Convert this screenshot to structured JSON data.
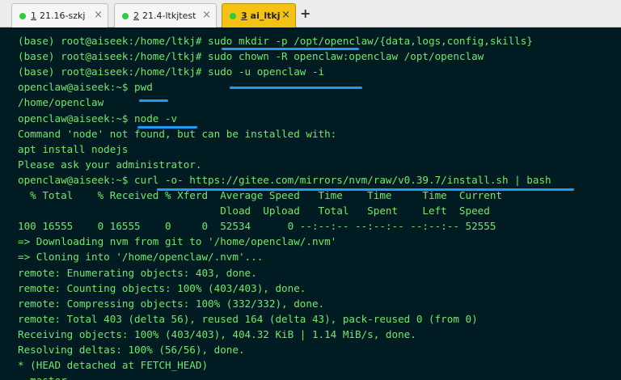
{
  "tabs": [
    {
      "number": "1",
      "label": "21.16-szkj",
      "dot_color": "#2ecc40",
      "active": false
    },
    {
      "number": "2",
      "label": "21.4-ltkjtest",
      "dot_color": "#2ecc40",
      "active": false
    },
    {
      "number": "3",
      "label": "ai_ltkj",
      "dot_color": "#2ecc40",
      "active": true
    }
  ],
  "close_glyph": "×",
  "add_tab_glyph": "+",
  "colors": {
    "terminal_bg": "#001b22",
    "terminal_text": "#72e86a",
    "highlight_underline": "#1f9cf0",
    "active_tab": "#f4c214"
  },
  "terminal": {
    "lines": [
      "(base) root@aiseek:/home/ltkj# sudo mkdir -p /opt/openclaw/{data,logs,config,skills}",
      "(base) root@aiseek:/home/ltkj# sudo chown -R openclaw:openclaw /opt/openclaw",
      "(base) root@aiseek:/home/ltkj# sudo -u openclaw -i",
      "openclaw@aiseek:~$ pwd",
      "/home/openclaw",
      "openclaw@aiseek:~$ node -v",
      "Command 'node' not found, but can be installed with:",
      "apt install nodejs",
      "Please ask your administrator.",
      "openclaw@aiseek:~$ curl -o- https://gitee.com/mirrors/nvm/raw/v0.39.7/install.sh | bash",
      "  % Total    % Received % Xferd  Average Speed   Time    Time     Time  Current",
      "                                 Dload  Upload   Total   Spent    Left  Speed",
      "100 16555    0 16555    0     0  52534      0 --:--:-- --:--:-- --:--:-- 52555",
      "=> Downloading nvm from git to '/home/openclaw/.nvm'",
      "=> Cloning into '/home/openclaw/.nvm'...",
      "remote: Enumerating objects: 403, done.",
      "remote: Counting objects: 100% (403/403), done.",
      "remote: Compressing objects: 100% (332/332), done.",
      "remote: Total 403 (delta 56), reused 164 (delta 43), pack-reused 0 (from 0)",
      "Receiving objects: 100% (403/403), 404.32 KiB | 1.14 MiB/s, done.",
      "Resolving deltas: 100% (56/56), done.",
      "* (HEAD detached at FETCH_HEAD)",
      "  master"
    ]
  }
}
